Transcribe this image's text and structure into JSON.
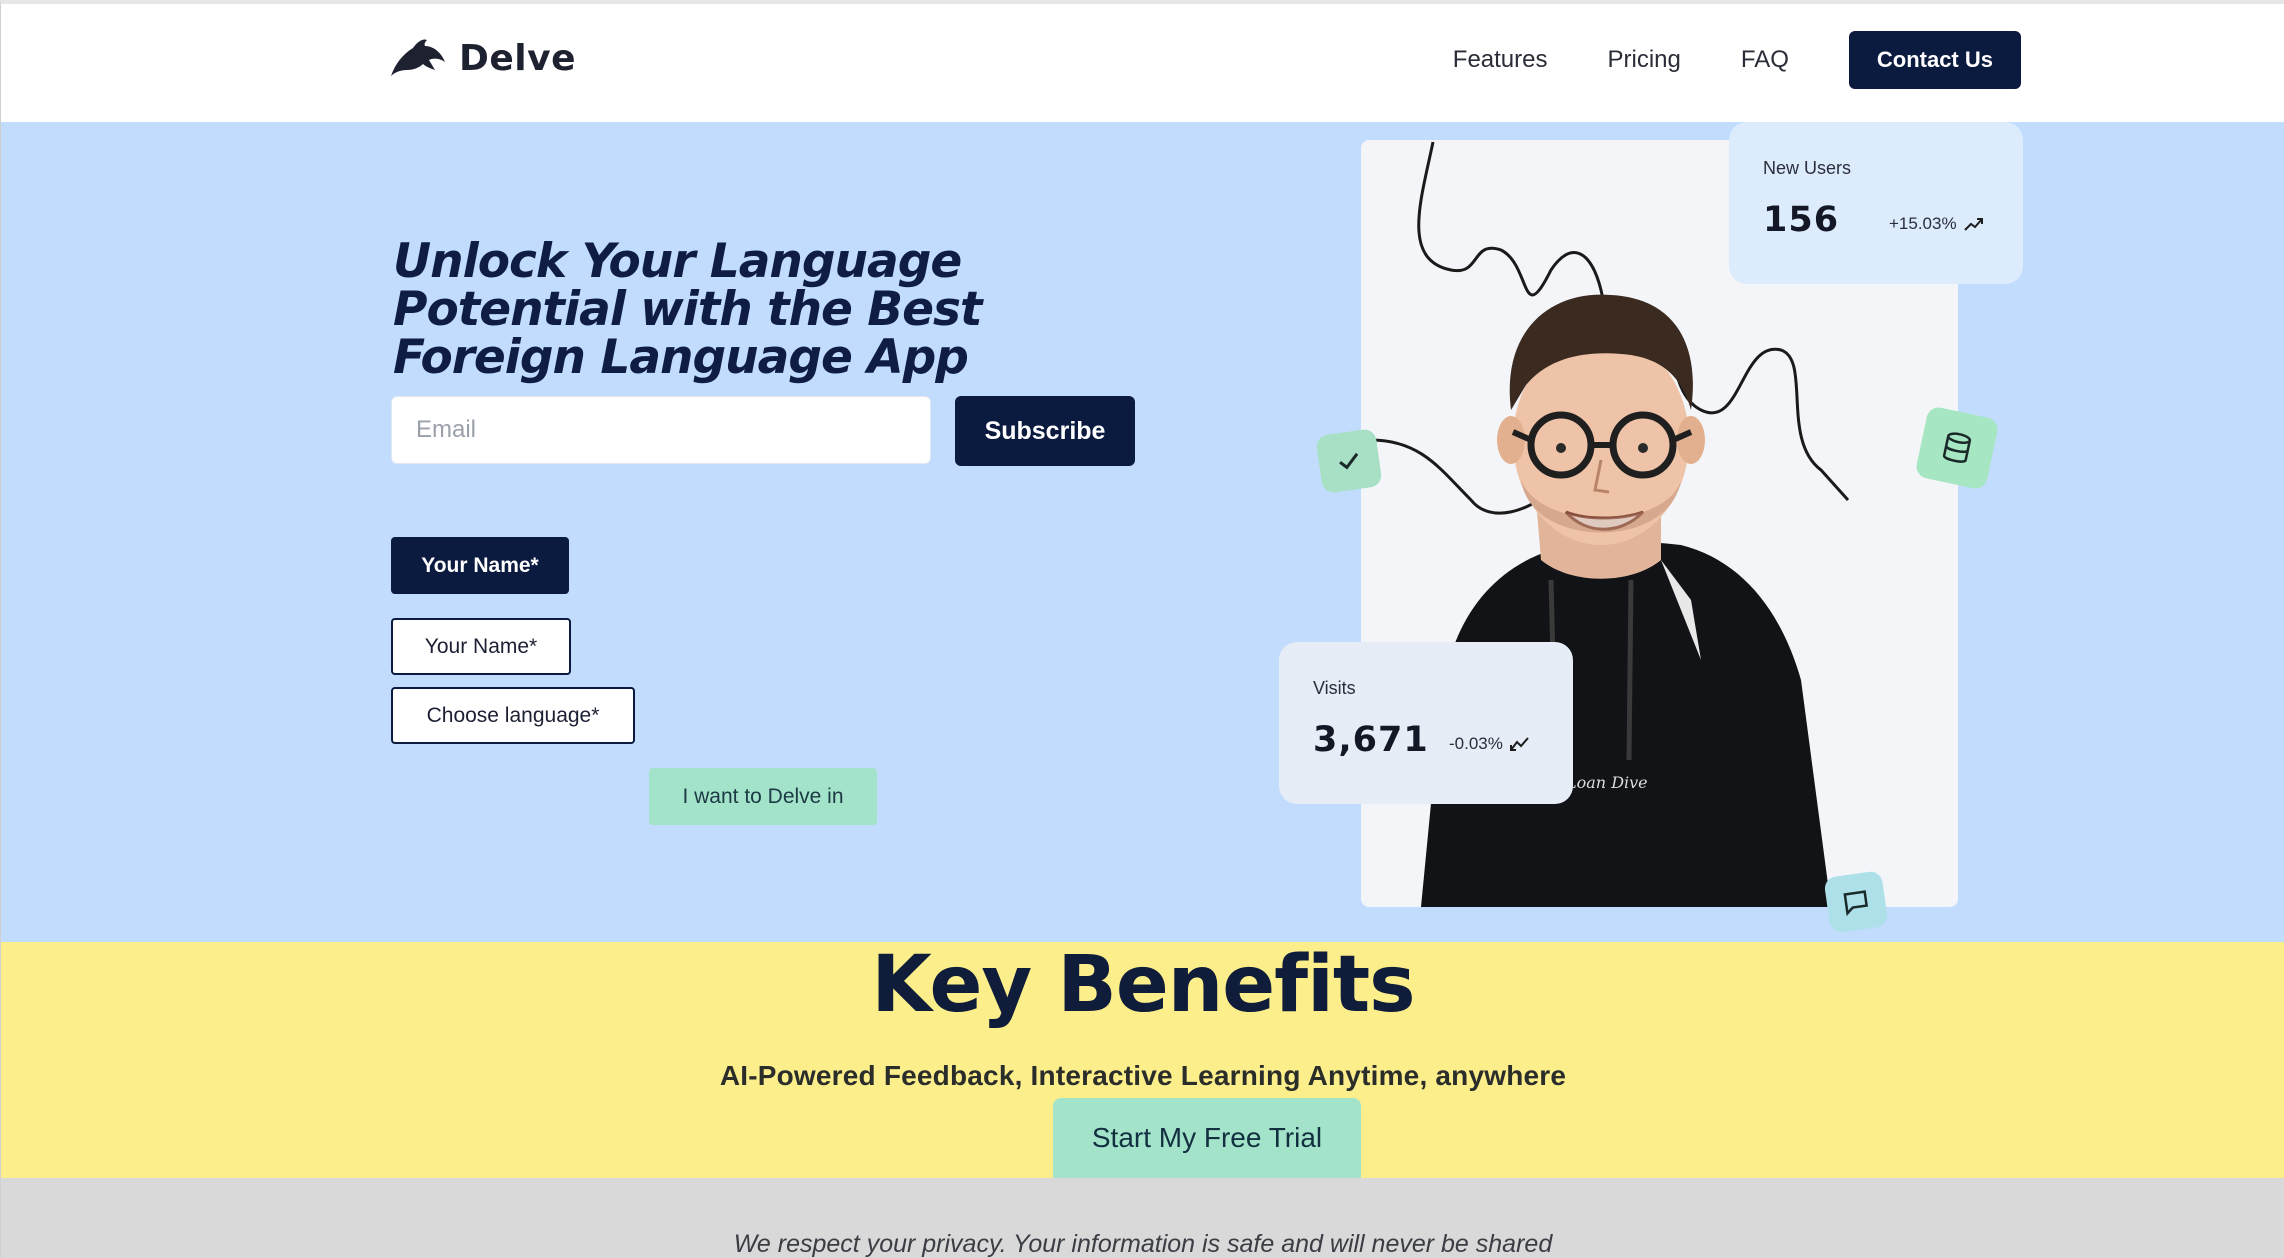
{
  "header": {
    "logo_text": "Delve",
    "nav": [
      "Features",
      "Pricing",
      "FAQ"
    ],
    "contact_label": "Contact Us"
  },
  "hero": {
    "title": "Unlock Your Language Potential with the Best Foreign Language App",
    "email_placeholder": "Email",
    "subscribe_label": "Subscribe",
    "name_button_label": "Your Name*",
    "name_outline_label": "Your Name*",
    "language_label": "Choose language*",
    "delve_label": "I want to Delve in"
  },
  "stats": {
    "new_users": {
      "label": "New Users",
      "value": "156",
      "change": "+15.03%"
    },
    "visits": {
      "label": "Visits",
      "value": "3,671",
      "change": "-0.03%"
    }
  },
  "benefits": {
    "title": "Key Benefits",
    "subtitle": "AI-Powered Feedback, Interactive Learning Anytime, anywhere",
    "cta_label": "Start My Free Trial"
  },
  "privacy": {
    "text": "We respect your privacy. Your information is safe and will never be shared"
  },
  "colors": {
    "hero_bg": "#c1dcfc",
    "navy": "#0b1a3f",
    "mint": "#a3e3ca",
    "benefits_bg": "#fbee8b",
    "privacy_bg": "#d9d9d9"
  }
}
